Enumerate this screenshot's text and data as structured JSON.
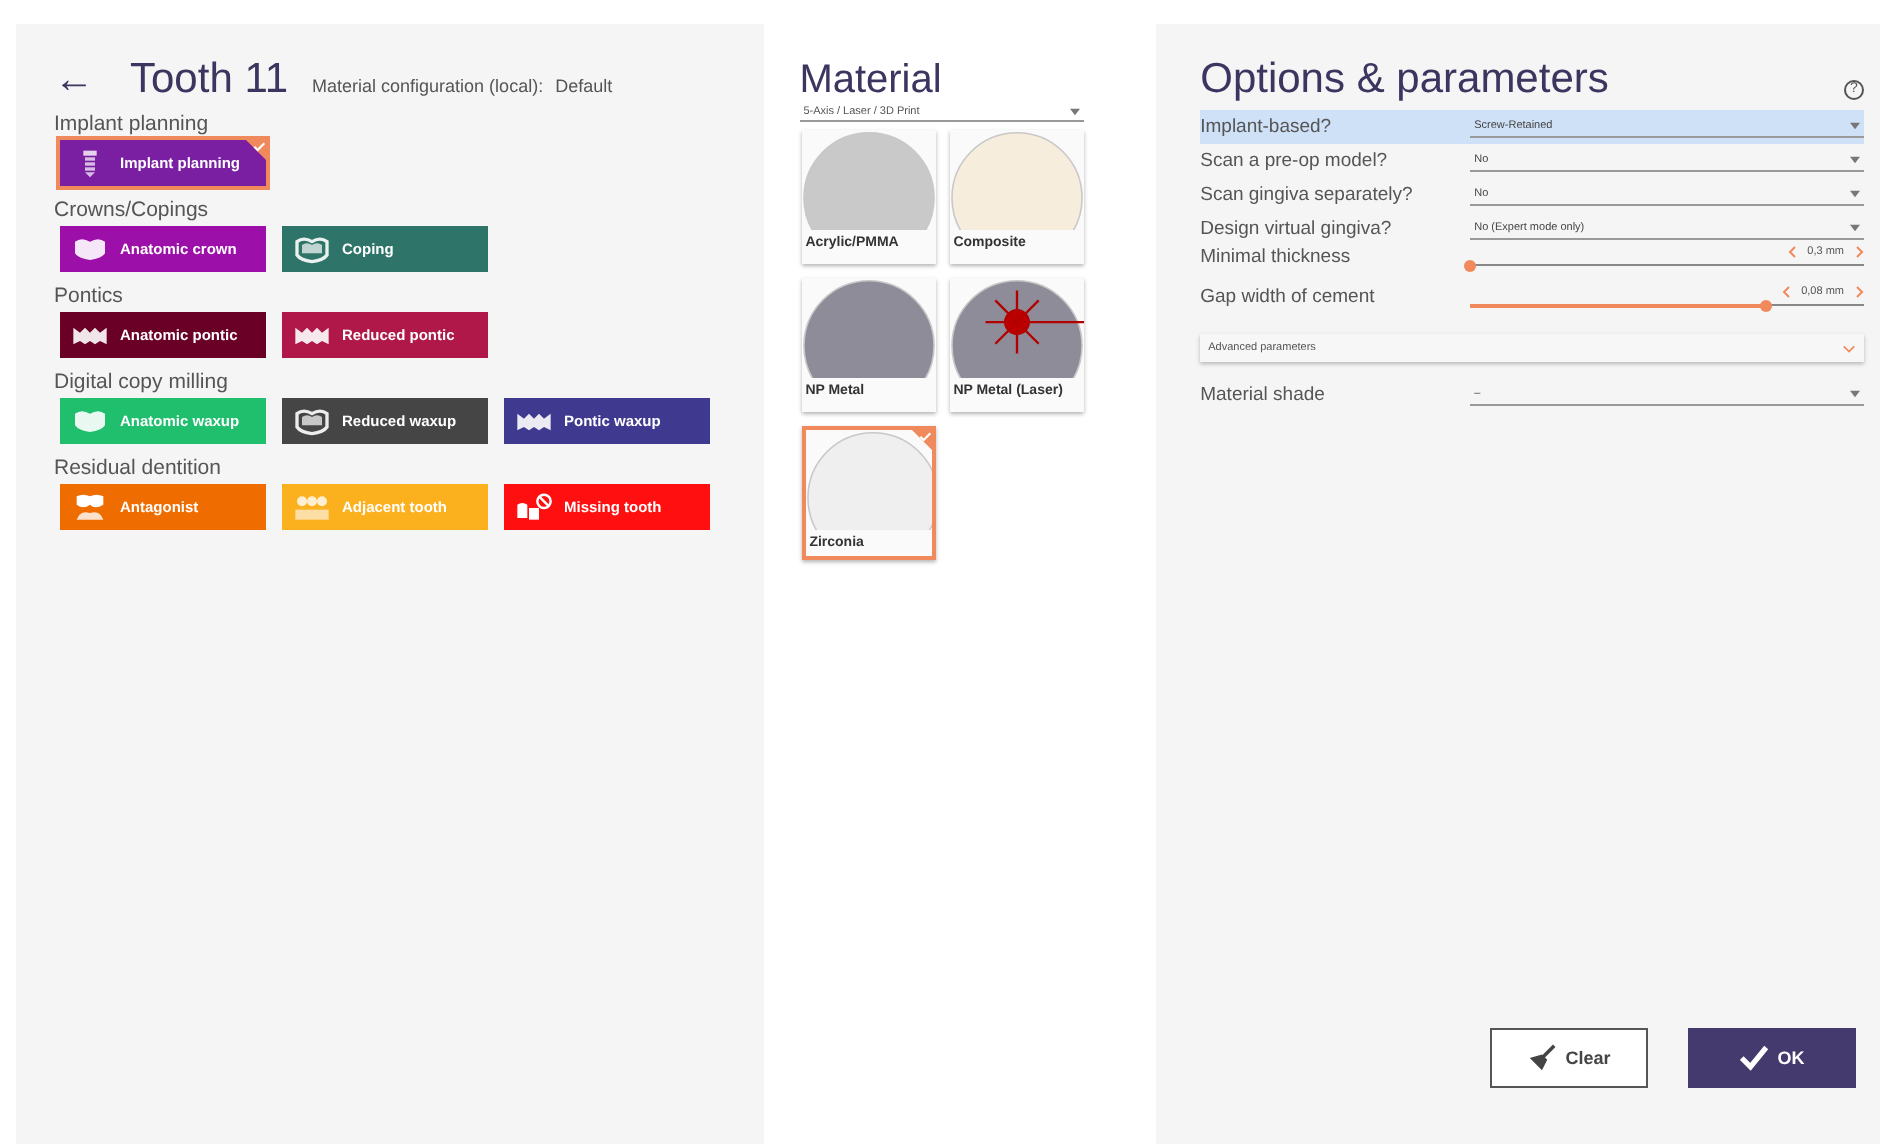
{
  "header": {
    "back": "←",
    "title": "Tooth 11",
    "config_label": "Material configuration (local):",
    "config_value": "Default"
  },
  "groups": [
    {
      "label": "Implant planning",
      "items": [
        {
          "label": "Implant planning",
          "kind": "implant",
          "color": "#7b1fa2",
          "selected": true
        }
      ]
    },
    {
      "label": "Crowns/Copings",
      "items": [
        {
          "label": "Anatomic crown",
          "kind": "crown",
          "color": "#9c0fa8",
          "selected": false
        },
        {
          "label": "Coping",
          "kind": "coping",
          "color": "#2e7468",
          "selected": false
        }
      ]
    },
    {
      "label": "Pontics",
      "items": [
        {
          "label": "Anatomic pontic",
          "kind": "pontic",
          "color": "#6b0026",
          "selected": false
        },
        {
          "label": "Reduced pontic",
          "kind": "pontic",
          "color": "#b0184a",
          "selected": false
        }
      ]
    },
    {
      "label": "Digital copy milling",
      "items": [
        {
          "label": "Anatomic waxup",
          "kind": "crown",
          "color": "#1fbf6e",
          "selected": false
        },
        {
          "label": "Reduced waxup",
          "kind": "coping",
          "color": "#454545",
          "selected": false
        },
        {
          "label": "Pontic waxup",
          "kind": "pontic",
          "color": "#3f3a90",
          "selected": false
        }
      ]
    },
    {
      "label": "Residual dentition",
      "items": [
        {
          "label": "Antagonist",
          "kind": "antagonist",
          "color": "#ef6c00",
          "selected": false
        },
        {
          "label": "Adjacent tooth",
          "kind": "adjacent",
          "color": "#fbb01e",
          "selected": false
        },
        {
          "label": "Missing tooth",
          "kind": "missing",
          "color": "#ff0f0f",
          "selected": false
        }
      ]
    }
  ],
  "material": {
    "title": "Material",
    "machine": "5-Axis / Laser / 3D Print",
    "items": [
      {
        "label": "Acrylic/PMMA",
        "color": "#c9c9c9",
        "laser": false,
        "selected": false
      },
      {
        "label": "Composite",
        "color": "#f7eddd",
        "laser": false,
        "selected": false
      },
      {
        "label": "NP Metal",
        "color": "#8d8c98",
        "laser": false,
        "selected": false
      },
      {
        "label": "NP Metal (Laser)",
        "color": "#8d8c98",
        "laser": true,
        "selected": false
      },
      {
        "label": "Zirconia",
        "color": "#eeefee",
        "laser": false,
        "selected": true
      }
    ]
  },
  "options": {
    "title": "Options & parameters",
    "help": "?",
    "rows": [
      {
        "kind": "select",
        "label": "Implant-based?",
        "value": "Screw-Retained",
        "selected": true
      },
      {
        "kind": "select",
        "label": "Scan a pre-op model?",
        "value": "No",
        "selected": false
      },
      {
        "kind": "select",
        "label": "Scan gingiva separately?",
        "value": "No",
        "selected": false
      },
      {
        "kind": "select",
        "label": "Design virtual gingiva?",
        "value": "No (Expert mode only)",
        "selected": false
      },
      {
        "kind": "slider",
        "label": "Minimal thickness",
        "value": "0,3 mm",
        "level": 0.0
      },
      {
        "kind": "slider",
        "label": "Gap width of cement",
        "value": "0,08 mm",
        "level": 0.75
      },
      {
        "kind": "expander",
        "label": "Advanced parameters"
      },
      {
        "kind": "select",
        "label": "Material shade",
        "value": "–",
        "selected": false
      }
    ]
  },
  "buttons": [
    {
      "kind": "clear",
      "label": "Clear"
    },
    {
      "kind": "ok",
      "label": "OK"
    }
  ]
}
